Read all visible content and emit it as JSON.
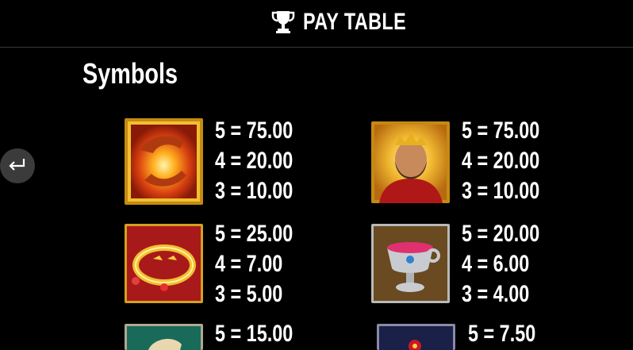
{
  "header": {
    "title": "PAY TABLE",
    "icon": "trophy-icon"
  },
  "section": {
    "title": "Symbols"
  },
  "back_button": {
    "icon": "return-arrow-icon"
  },
  "symbols": [
    {
      "name": "hands-orb",
      "pays": [
        "5 = 75.00",
        "4 = 20.00",
        "3 = 10.00"
      ]
    },
    {
      "name": "king",
      "pays": [
        "5 = 75.00",
        "4 = 20.00",
        "3 = 10.00"
      ]
    },
    {
      "name": "ring",
      "pays": [
        "5 = 25.00",
        "4 = 7.00",
        "3 = 5.00"
      ]
    },
    {
      "name": "chalice",
      "pays": [
        "5 = 20.00",
        "4 = 6.00",
        "3 = 4.00"
      ]
    },
    {
      "name": "scroll",
      "pays": [
        "5 = 15.00"
      ]
    },
    {
      "name": "gem",
      "pays": [
        "5 = 7.50"
      ]
    }
  ],
  "colors": {
    "background": "#000000",
    "text": "#ffffff",
    "gold_frame": "#e8b020",
    "back_button": "#3b3b3b"
  }
}
